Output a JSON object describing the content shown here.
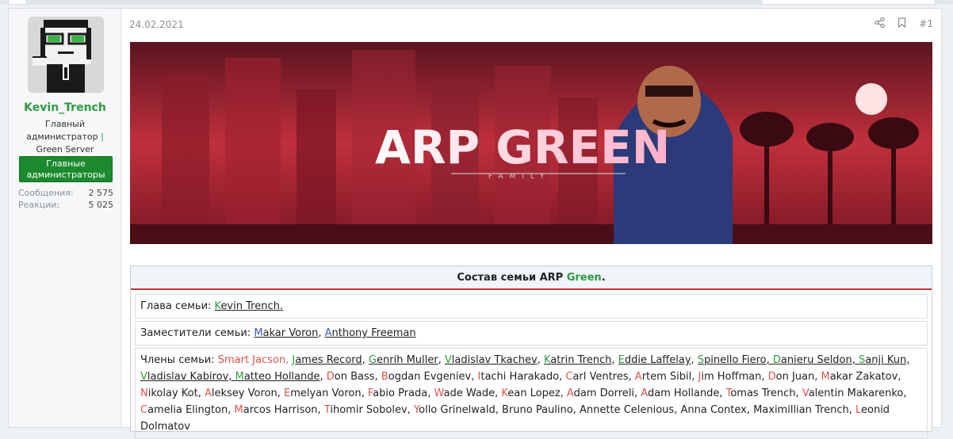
{
  "post": {
    "date": "24.02.2021",
    "number": "#1",
    "share_icon": "share-icon",
    "bookmark_icon": "bookmark-icon"
  },
  "user": {
    "name": "Kevin_Trench",
    "title_line1": "Главный",
    "title_line2": "администратор",
    "title_sep": "|",
    "title_line3": "Green Server",
    "role_banner_1": "Главные",
    "role_banner_2": "администраторы",
    "stats": [
      {
        "label": "Сообщения:",
        "value": "2 575"
      },
      {
        "label": "Реакции:",
        "value": "5 025"
      }
    ]
  },
  "banner": {
    "title": "ARP GREEN",
    "subtitle": "FAMILY"
  },
  "table": {
    "header_prefix": "Состав семьи ARP ",
    "header_green": "Green",
    "header_suffix": ".",
    "head_label": "Глава семьи: ",
    "head_cap": "K",
    "head_name": "evin Trench.",
    "deputies_label": "Заместители семьи: ",
    "deputies": [
      {
        "cap": "M",
        "rest": "akar Voron"
      },
      {
        "cap": "A",
        "rest": "nthony Freeman"
      }
    ],
    "members_label": "Члены семьи: ",
    "members_line": [
      {
        "cap": "S",
        "rest": "mart Jacson, ",
        "capColor": "red",
        "restColor": "red",
        "u": false
      },
      {
        "cap": "J",
        "rest": "ames Record",
        "capColor": "green",
        "restColor": "",
        "u": true
      },
      {
        "cap": "G",
        "rest": "enrih Muller",
        "capColor": "green",
        "restColor": "",
        "u": true
      },
      {
        "cap": "V",
        "rest": "ladislav Tkachev",
        "capColor": "green",
        "restColor": "",
        "u": true
      },
      {
        "cap": "K",
        "rest": "atrin Trench",
        "capColor": "green",
        "restColor": "",
        "u": true
      },
      {
        "cap": "E",
        "rest": "ddie Laffelay",
        "capColor": "green",
        "restColor": "",
        "u": true
      },
      {
        "cap": "S",
        "rest": "pinello Fiero, ",
        "capColor": "green",
        "restColor": "",
        "u": true
      },
      {
        "cap": "D",
        "rest": "anieru Seldon, ",
        "capColor": "green",
        "restColor": "",
        "u": true
      },
      {
        "cap": "S",
        "rest": "anji Kun, ",
        "capColor": "green",
        "restColor": "",
        "u": true
      },
      {
        "cap": "V",
        "rest": "ladislav Kabirov, ",
        "capColor": "green",
        "restColor": "",
        "u": true
      },
      {
        "cap": "M",
        "rest": "atteo Hollande",
        "capColor": "green",
        "restColor": "",
        "u": true
      },
      {
        "cap": "D",
        "rest": "on Bass",
        "capColor": "red",
        "restColor": "",
        "u": false
      },
      {
        "cap": "B",
        "rest": "ogdan Evgeniev",
        "capColor": "red",
        "restColor": "",
        "u": false
      },
      {
        "cap": "I",
        "rest": "tachi Harakado",
        "capColor": "red",
        "restColor": "",
        "u": false
      },
      {
        "cap": "C",
        "rest": "arl Ventres",
        "capColor": "red",
        "restColor": "",
        "u": false
      },
      {
        "cap": "A",
        "rest": "rtem Sibil",
        "capColor": "red",
        "restColor": "",
        "u": false
      },
      {
        "cap": "J",
        "rest": "im Hoffman",
        "capColor": "red",
        "restColor": "",
        "u": false
      },
      {
        "cap": "D",
        "rest": "on Juan",
        "capColor": "red",
        "restColor": "",
        "u": false
      },
      {
        "cap": "M",
        "rest": "akar Zakatov",
        "capColor": "red",
        "restColor": "",
        "u": false
      },
      {
        "cap": "N",
        "rest": "ikolay Kot",
        "capColor": "red",
        "restColor": "",
        "u": false
      },
      {
        "cap": "A",
        "rest": "leksey Voron",
        "capColor": "red",
        "restColor": "",
        "u": false
      },
      {
        "cap": "E",
        "rest": "melyan Voron",
        "capColor": "red",
        "restColor": "",
        "u": false
      },
      {
        "cap": "F",
        "rest": "abio Prada",
        "capColor": "red",
        "restColor": "",
        "u": false
      },
      {
        "cap": "W",
        "rest": "ade Wade",
        "capColor": "red",
        "restColor": "",
        "u": false
      },
      {
        "cap": "K",
        "rest": "ean Lopez",
        "capColor": "red",
        "restColor": "",
        "u": false
      },
      {
        "cap": "A",
        "rest": "dam Dorreli",
        "capColor": "red",
        "restColor": "",
        "u": false
      },
      {
        "cap": "A",
        "rest": "dam Hollande",
        "capColor": "red",
        "restColor": "",
        "u": false
      },
      {
        "cap": "T",
        "rest": "omas Trench",
        "capColor": "red",
        "restColor": "",
        "u": false
      },
      {
        "cap": "V",
        "rest": "alentin Makarenko",
        "capColor": "red",
        "restColor": "",
        "u": false
      },
      {
        "cap": "C",
        "rest": "amelia Elington",
        "capColor": "red",
        "restColor": "",
        "u": false
      },
      {
        "cap": "M",
        "rest": "arcos Harrison",
        "capColor": "red",
        "restColor": "",
        "u": false
      },
      {
        "cap": "T",
        "rest": "ihomir Sobolev",
        "capColor": "red",
        "restColor": "",
        "u": false
      },
      {
        "cap": "Y",
        "rest": "ollo Grinelwald",
        "capColor": "red",
        "restColor": "",
        "u": false
      },
      {
        "cap": "B",
        "rest": "runo Paulino",
        "capColor": "",
        "restColor": "",
        "u": false
      },
      {
        "cap": "A",
        "rest": "nnette Celenious",
        "capColor": "",
        "restColor": "",
        "u": false
      },
      {
        "cap": "A",
        "rest": "nna Contex",
        "capColor": "",
        "restColor": "",
        "u": false
      },
      {
        "cap": "M",
        "rest": "aximillian Trench",
        "capColor": "",
        "restColor": "",
        "u": false
      },
      {
        "cap": "L",
        "rest": "eonid Dolmatov",
        "capColor": "red",
        "restColor": "",
        "u": false
      }
    ]
  },
  "colors": {
    "username_green": "#2f9a3f",
    "role_banner": "#1c8a2e",
    "header_rule": "#b23b3b",
    "member_red": "#d9534f"
  }
}
